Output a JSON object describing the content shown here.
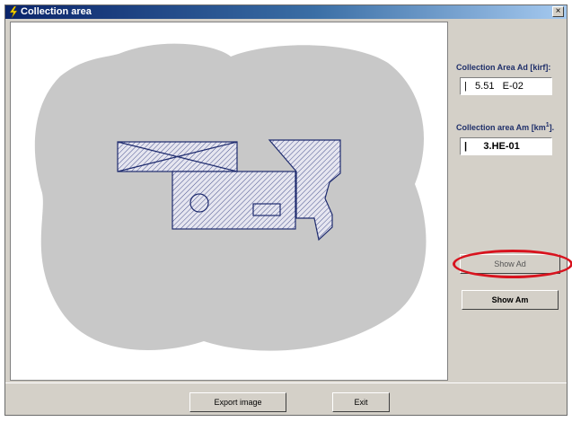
{
  "window": {
    "title": "Collection area",
    "close_glyph": "×"
  },
  "results": {
    "ad_label": "Collection Area Ad [kirf]:",
    "ad_value": "|   5.51   E-02",
    "am_label_main": "Collection area Am [km",
    "am_label_sup": "1",
    "am_label_end": "].",
    "am_value": "|      3.HE-01"
  },
  "buttons": {
    "show_ad": "Show Ad",
    "show_am": "Show Am",
    "export_image": "Export image",
    "exit": "Exit"
  },
  "colors": {
    "collection_area_fill": "#c8c8c8",
    "structure_outline": "#1e2b6e",
    "highlight_ring": "#d8131e",
    "title_gradient_start": "#0a246a"
  },
  "icons": {
    "app": "lightning-icon",
    "close": "close-icon"
  }
}
